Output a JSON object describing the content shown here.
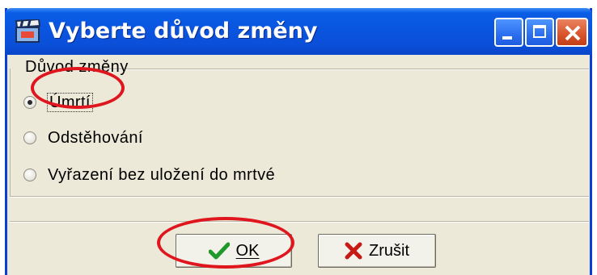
{
  "window": {
    "title": "Vyberte důvod změny",
    "title_icon": "clapperboard-icon",
    "controls": {
      "minimize_icon": "minimize-icon",
      "maximize_icon": "maximize-icon",
      "close_icon": "close-icon"
    }
  },
  "group": {
    "label": "Důvod změny",
    "options": [
      {
        "label": "Úmrtí",
        "checked": true
      },
      {
        "label": "Odstěhování",
        "checked": false
      },
      {
        "label": "Vyřazení bez uložení do mrtvé",
        "checked": false
      }
    ]
  },
  "buttons": {
    "ok": {
      "label": "OK",
      "icon": "checkmark-icon"
    },
    "cancel": {
      "label": "Zrušit",
      "icon": "x-icon"
    }
  },
  "colors": {
    "titlebar": "#0a55e0",
    "annotation": "#e0161e",
    "dialog_bg": "#ece9d8"
  }
}
